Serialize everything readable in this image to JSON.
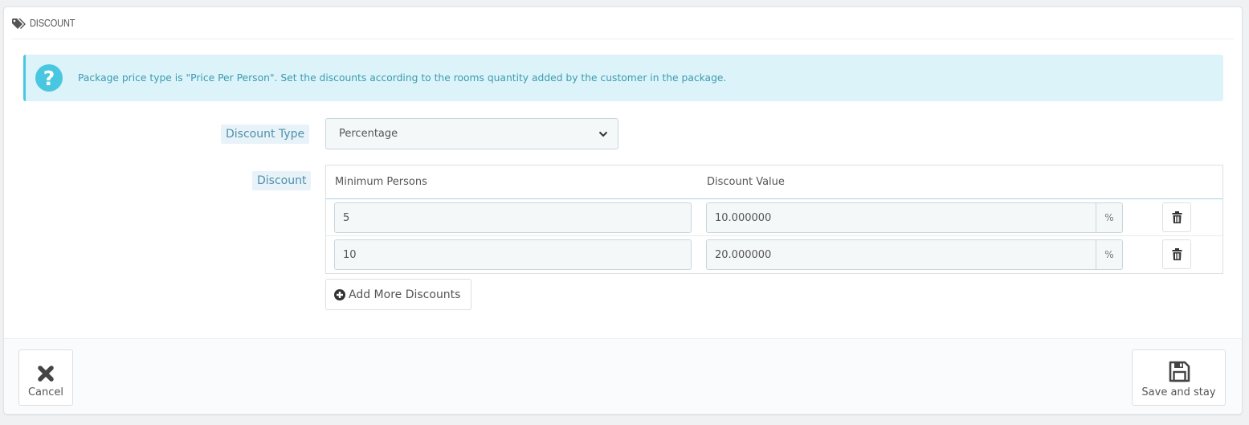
{
  "panel": {
    "title": "DISCOUNT",
    "title_icon": "tags-icon"
  },
  "alert": {
    "icon": "question-circle-icon",
    "text": "Package price type is \"Price Per Person\". Set the discounts according to the rooms quantity added by the customer in the package.",
    "color": "#4ac7e0"
  },
  "form": {
    "discount_type_label": "Discount Type",
    "discount_type_value": "Percentage",
    "discount_label": "Discount"
  },
  "discount_table": {
    "headers": {
      "min_persons": "Minimum Persons",
      "discount_value": "Discount Value"
    },
    "rows": [
      {
        "min_persons": "5",
        "discount_value": "10.000000",
        "unit": "%"
      },
      {
        "min_persons": "10",
        "discount_value": "20.000000",
        "unit": "%"
      }
    ],
    "add_button_label": "Add More Discounts"
  },
  "footer": {
    "cancel_label": "Cancel",
    "save_label": "Save and stay"
  }
}
